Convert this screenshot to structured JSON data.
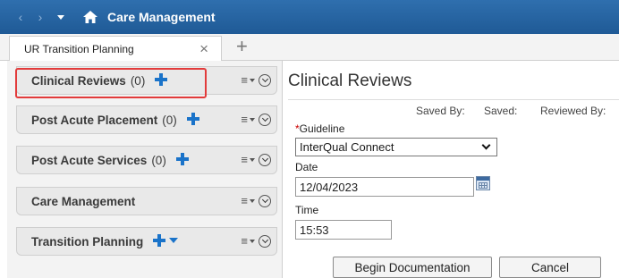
{
  "app": {
    "title": "Care Management"
  },
  "tabs": [
    {
      "label": "UR Transition Planning",
      "close_glyph": "×"
    }
  ],
  "add_tab_glyph": "+",
  "sections": [
    {
      "label": "Clinical Reviews",
      "count": "(0)",
      "has_add": true,
      "has_dropdown": false
    },
    {
      "label": "Post Acute Placement",
      "count": "(0)",
      "has_add": true,
      "has_dropdown": false
    },
    {
      "label": "Post Acute Services",
      "count": "(0)",
      "has_add": true,
      "has_dropdown": false
    },
    {
      "label": "Care Management",
      "count": "",
      "has_add": false,
      "has_dropdown": false
    },
    {
      "label": "Transition Planning",
      "count": "",
      "has_add": true,
      "has_dropdown": true
    }
  ],
  "panel": {
    "title": "Clinical Reviews",
    "saved_by_label": "Saved By:",
    "saved_label": "Saved:",
    "reviewed_by_label": "Reviewed By:",
    "guideline_required_mark": "*",
    "guideline_label": "Guideline",
    "guideline_value": "InterQual Connect",
    "date_label": "Date",
    "date_value": "12/04/2023",
    "time_label": "Time",
    "time_value": "15:53",
    "begin_button": "Begin Documentation",
    "cancel_button": "Cancel"
  },
  "colors": {
    "titlebar": "#2a68a6",
    "accent_blue": "#1a73c9",
    "highlight_red": "#e23b3b",
    "required_red": "#cc0000"
  }
}
